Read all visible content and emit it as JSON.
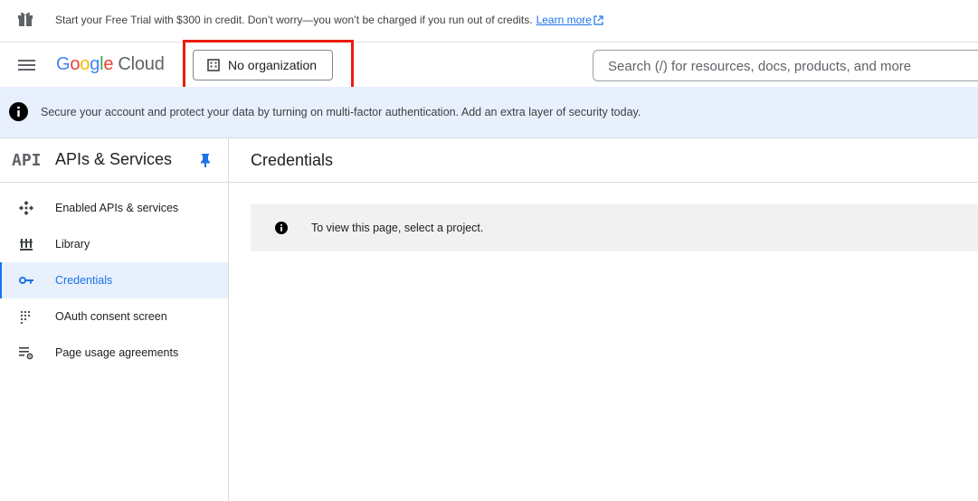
{
  "promo": {
    "text": "Start your Free Trial with $300 in credit. Don’t worry—you won’t be charged if you run out of credits.",
    "link": "Learn more"
  },
  "header": {
    "logo_google": "Google",
    "logo_cloud": "Cloud",
    "org_label": "No organization",
    "search_placeholder": "Search (/) for resources, docs, products, and more"
  },
  "banner": {
    "message": "Secure your account and protect your data by turning on multi-factor authentication. Add an extra layer of security today."
  },
  "sidebar": {
    "icon_text": "API",
    "title": "APIs & Services",
    "items": [
      {
        "label": "Enabled APIs & services",
        "icon": "api-hub-icon"
      },
      {
        "label": "Library",
        "icon": "library-icon"
      },
      {
        "label": "Credentials",
        "icon": "key-icon",
        "active": true
      },
      {
        "label": "OAuth consent screen",
        "icon": "consent-grid-icon"
      },
      {
        "label": "Page usage agreements",
        "icon": "settings-list-icon"
      }
    ]
  },
  "main": {
    "title": "Credentials",
    "notice": "To view this page, select a project."
  },
  "colors": {
    "accent": "#1a73e8",
    "banner_bg": "#e8f0fe",
    "highlight": "#ea1c0d"
  }
}
